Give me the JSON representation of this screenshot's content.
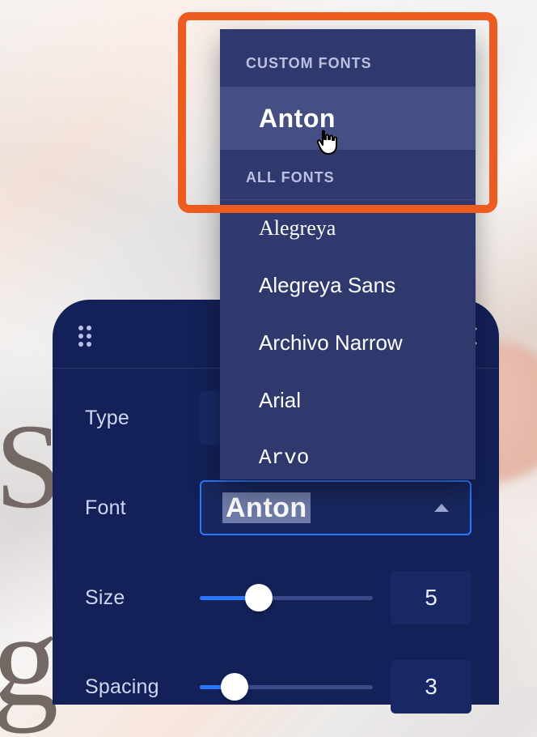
{
  "background_letters": [
    "S",
    "g"
  ],
  "panel": {
    "rows": {
      "type": {
        "label": "Type"
      },
      "font": {
        "label": "Font",
        "selected": "Anton"
      },
      "size": {
        "label": "Size",
        "value": "5",
        "fill_pct": 34
      },
      "spacing": {
        "label": "Spacing",
        "value": "3",
        "fill_pct": 20
      }
    }
  },
  "dropdown": {
    "headers": {
      "custom": "CUSTOM FONTS",
      "all": "ALL FONTS"
    },
    "custom_items": [
      {
        "label": "Anton",
        "selected": true
      }
    ],
    "all_items": [
      {
        "label": "Alegreya",
        "class": "f-alegreya"
      },
      {
        "label": "Alegreya Sans",
        "class": "f-alegreya-sans"
      },
      {
        "label": "Archivo Narrow",
        "class": "f-archivo"
      },
      {
        "label": "Arial",
        "class": "f-arial"
      },
      {
        "label": "Arvo",
        "class": "f-arvo"
      }
    ]
  },
  "colors": {
    "panel_bg": "#132158",
    "panel_accent": "#2c77ff",
    "dropdown_bg": "#2f396e",
    "dropdown_sel": "#454f84",
    "highlight": "#ee5b1e"
  }
}
